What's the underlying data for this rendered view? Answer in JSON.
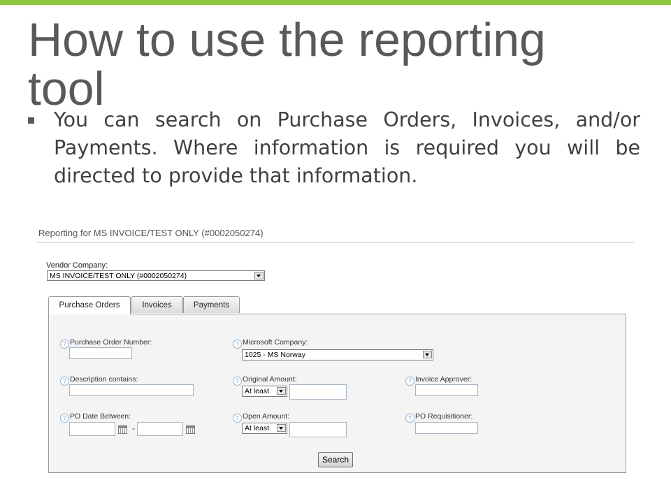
{
  "slide": {
    "title": "How to use the reporting tool",
    "bullet": "You can search on Purchase Orders, Invoices, and/or Payments. Where information is required you will be directed to provide that information."
  },
  "app": {
    "title": "Reporting for MS INVOICE/TEST ONLY (#0002050274)",
    "vendor_label": "Vendor Company:",
    "vendor_value": "MS INVOICE/TEST ONLY (#0002050274)",
    "tabs": [
      {
        "label": "Purchase Orders",
        "active": true
      },
      {
        "label": "Invoices",
        "active": false
      },
      {
        "label": "Payments",
        "active": false
      }
    ],
    "help_glyph": "?",
    "fields": {
      "po_number": "Purchase Order Number:",
      "description": "Description contains:",
      "po_date": "PO Date Between:",
      "date_separator": "-",
      "ms_company": "Microsoft Company:",
      "ms_company_value": "1025 - MS Norway",
      "original_amount": "Original Amount:",
      "original_amount_op": "At least",
      "open_amount": "Open Amount:",
      "open_amount_op": "At least",
      "invoice_approver": "Invoice Approver:",
      "po_requisitioner": "PO Requisitioner:"
    },
    "search_button": "Search"
  },
  "colors": {
    "accent_bar": "#8dc63f",
    "title_text": "#595959",
    "help_icon": "#6f98c4"
  },
  "icons": [
    "help-icon",
    "calendar-icon",
    "dropdown-arrow-icon"
  ]
}
